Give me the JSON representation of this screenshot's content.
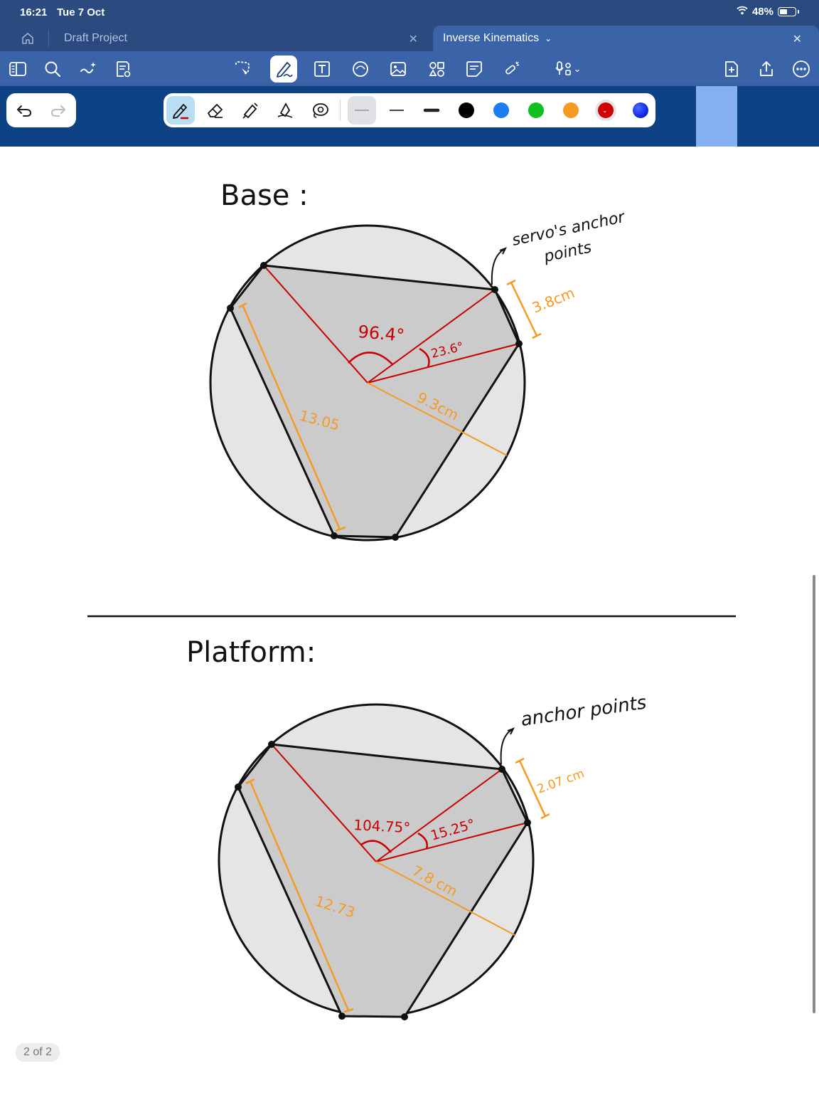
{
  "status_bar": {
    "time": "16:21",
    "date": "Tue 7 Oct",
    "battery": "48%",
    "battery_level": 0.48
  },
  "tabs": [
    {
      "label": "Draft Project",
      "active": false
    },
    {
      "label": "Inverse Kinematics",
      "active": true
    }
  ],
  "toolbar": {
    "icons": [
      "sidebar-icon",
      "search-icon",
      "magic-icon",
      "page-settings-icon",
      "lasso-icon",
      "pen-icon",
      "text-box-icon",
      "shape-icon",
      "image-icon",
      "elements-icon",
      "sticky-note-icon",
      "laser-pointer-icon",
      "record-audio-icon",
      "add-page-icon",
      "share-icon",
      "more-icon"
    ]
  },
  "pen_bar": {
    "tools": [
      "pen-tool",
      "eraser-tool",
      "highlighter-tool",
      "shape-tool",
      "lasso-tool"
    ],
    "colors": [
      "#000000",
      "#1a7ff0",
      "#10c020",
      "#f59a23",
      "#d10000",
      "#1028e8"
    ],
    "selected_color": "#d10000"
  },
  "notes": {
    "base": {
      "title": "Base :",
      "callout": [
        "servo's anchor",
        "points"
      ],
      "angle_large": "96.4°",
      "angle_small": "23.6°",
      "radius": "9.3cm",
      "anchor_gap": "3.8cm",
      "side_length": "13.05"
    },
    "platform": {
      "title": "Platform:",
      "callout": "anchor points",
      "angle_large": "104.75°",
      "angle_small": "15.25°",
      "radius": "7.8 cm",
      "anchor_gap": "2.07 cm",
      "side_length": "12.73"
    }
  },
  "page_indicator": "2 of 2"
}
